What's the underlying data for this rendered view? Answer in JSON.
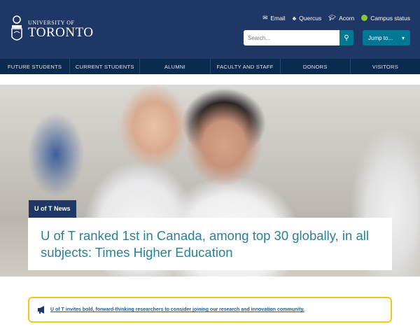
{
  "header": {
    "logo_line1": "UNIVERSITY OF",
    "logo_line2": "TORONTO",
    "utility": [
      {
        "label": "Email",
        "icon": "envelope-icon"
      },
      {
        "label": "Quercus",
        "icon": "tree-icon"
      },
      {
        "label": "Acorn",
        "icon": "grad-cap-icon"
      },
      {
        "label": "Campus status",
        "icon": "status-dot-icon"
      }
    ],
    "search_placeholder": "Search...",
    "jump_label": "Jump to...",
    "status_color": "#8bc53f"
  },
  "nav": [
    "FUTURE STUDENTS",
    "CURRENT STUDENTS",
    "ALUMNI",
    "FACULTY AND STAFF",
    "DONORS",
    "VISITORS"
  ],
  "hero": {
    "tag": "U of T News",
    "headline": "U of T ranked 1st in Canada, among top 30 globally, in all subjects: Times Higher Education"
  },
  "alert": {
    "text": "U of T invites bold, forward-thinking researchers to consider joining our research and innovation community."
  }
}
